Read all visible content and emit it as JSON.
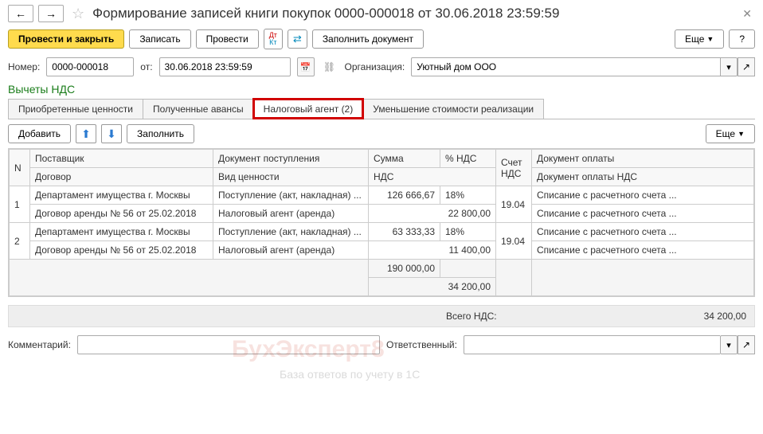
{
  "header": {
    "title": "Формирование записей книги покупок 0000-000018 от 30.06.2018 23:59:59"
  },
  "toolbar": {
    "post_close": "Провести и закрыть",
    "save": "Записать",
    "post": "Провести",
    "fill_doc": "Заполнить документ",
    "more": "Еще",
    "help": "?"
  },
  "form": {
    "number_label": "Номер:",
    "number_value": "0000-000018",
    "from_label": "от:",
    "date_value": "30.06.2018 23:59:59",
    "org_label": "Организация:",
    "org_value": "Уютный дом ООО"
  },
  "section_title": "Вычеты НДС",
  "tabs": {
    "t1": "Приобретенные ценности",
    "t2": "Полученные авансы",
    "t3": "Налоговый агент (2)",
    "t4": "Уменьшение стоимости реализации"
  },
  "grid_toolbar": {
    "add": "Добавить",
    "fill": "Заполнить",
    "more": "Еще"
  },
  "columns": {
    "n": "N",
    "supplier": "Поставщик",
    "contract": "Договор",
    "doc": "Документ поступления",
    "value_type": "Вид ценности",
    "sum": "Сумма",
    "vat_pct": "% НДС",
    "vat": "НДС",
    "acct": "Счет НДС",
    "pay_doc": "Документ оплаты",
    "pay_doc_vat": "Документ оплаты НДС"
  },
  "rows": [
    {
      "n": "1",
      "supplier": "Департамент имущества г. Москвы",
      "contract": "Договор аренды № 56 от 25.02.2018",
      "doc": "Поступление (акт, накладная) ...",
      "value_type": "Налоговый агент (аренда)",
      "sum": "126 666,67",
      "vat_pct": "18%",
      "vat": "22 800,00",
      "acct": "19.04",
      "pay_doc": "Списание с расчетного счета ...",
      "pay_doc_vat": "Списание с расчетного счета ..."
    },
    {
      "n": "2",
      "supplier": "Департамент имущества г. Москвы",
      "contract": "Договор аренды № 56 от 25.02.2018",
      "doc": "Поступление (акт, накладная) ...",
      "value_type": "Налоговый агент (аренда)",
      "sum": "63 333,33",
      "vat_pct": "18%",
      "vat": "11 400,00",
      "acct": "19.04",
      "pay_doc": "Списание с расчетного счета ...",
      "pay_doc_vat": "Списание с расчетного счета ..."
    }
  ],
  "totals": {
    "sum": "190 000,00",
    "vat": "34 200,00"
  },
  "footer": {
    "vat_total_label": "Всего НДС:",
    "vat_total_value": "34 200,00",
    "comment_label": "Комментарий:",
    "responsible_label": "Ответственный:"
  },
  "watermark": {
    "main": "БухЭксперт8",
    "sub": "База ответов по учету в 1С"
  }
}
